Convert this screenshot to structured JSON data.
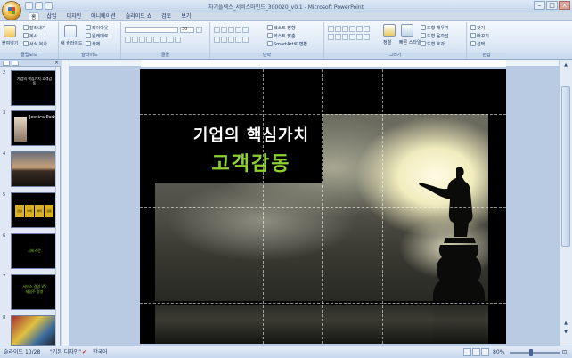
{
  "window": {
    "title": "차기플렉스_서비스마인드_300020_v0.1 - Microsoft PowerPoint"
  },
  "tabs": [
    "홈",
    "삽입",
    "디자인",
    "애니메이션",
    "슬라이드 쇼",
    "검토",
    "보기"
  ],
  "ribbon": {
    "clipboard": {
      "label": "클립보드",
      "paste": "붙여넣기",
      "cut": "잘라내기",
      "copy": "복사",
      "format_painter": "서식 복사"
    },
    "slides": {
      "label": "슬라이드",
      "new_slide": "새 슬라이드",
      "layout": "레이아웃",
      "reset": "원래대로",
      "delete": "삭제"
    },
    "font": {
      "label": "글꼴",
      "font_size": "30"
    },
    "paragraph": {
      "label": "단락",
      "text_direction": "텍스트 방향",
      "align_text": "텍스트 맞춤",
      "smartart": "SmartArt로 변환"
    },
    "drawing": {
      "label": "그리기",
      "arrange": "정렬",
      "quick_styles": "빠른 스타일",
      "shape_fill": "도형 채우기",
      "shape_outline": "도형 윤곽선",
      "shape_effects": "도형 효과"
    },
    "editing": {
      "label": "편집",
      "find": "찾기",
      "replace": "바꾸기",
      "select": "선택"
    }
  },
  "thumbnails": [
    {
      "num": "2",
      "text": "기업의 핵심가치 고객감동"
    },
    {
      "num": "3",
      "text": "Jessica Park"
    },
    {
      "num": "4",
      "text": ""
    },
    {
      "num": "5",
      "text": ""
    },
    {
      "num": "6",
      "text": "서비스란"
    },
    {
      "num": "7",
      "text": "서비스 경영 VS 제일주 경영"
    },
    {
      "num": "8",
      "text": ""
    }
  ],
  "thumb_labels_5": [
    "관심",
    "이해",
    "배려",
    "감동"
  ],
  "slide": {
    "title": "기업의 핵심가치",
    "subtitle": "고객감동"
  },
  "colors": {
    "subtitle": "#8dd12f",
    "title": "#ffffff",
    "selection": "#f2b33a"
  },
  "status": {
    "slide_indicator": "슬라이드 10/28",
    "theme": "\"기본 디자인\"",
    "language": "한국어",
    "zoom": "80%"
  }
}
